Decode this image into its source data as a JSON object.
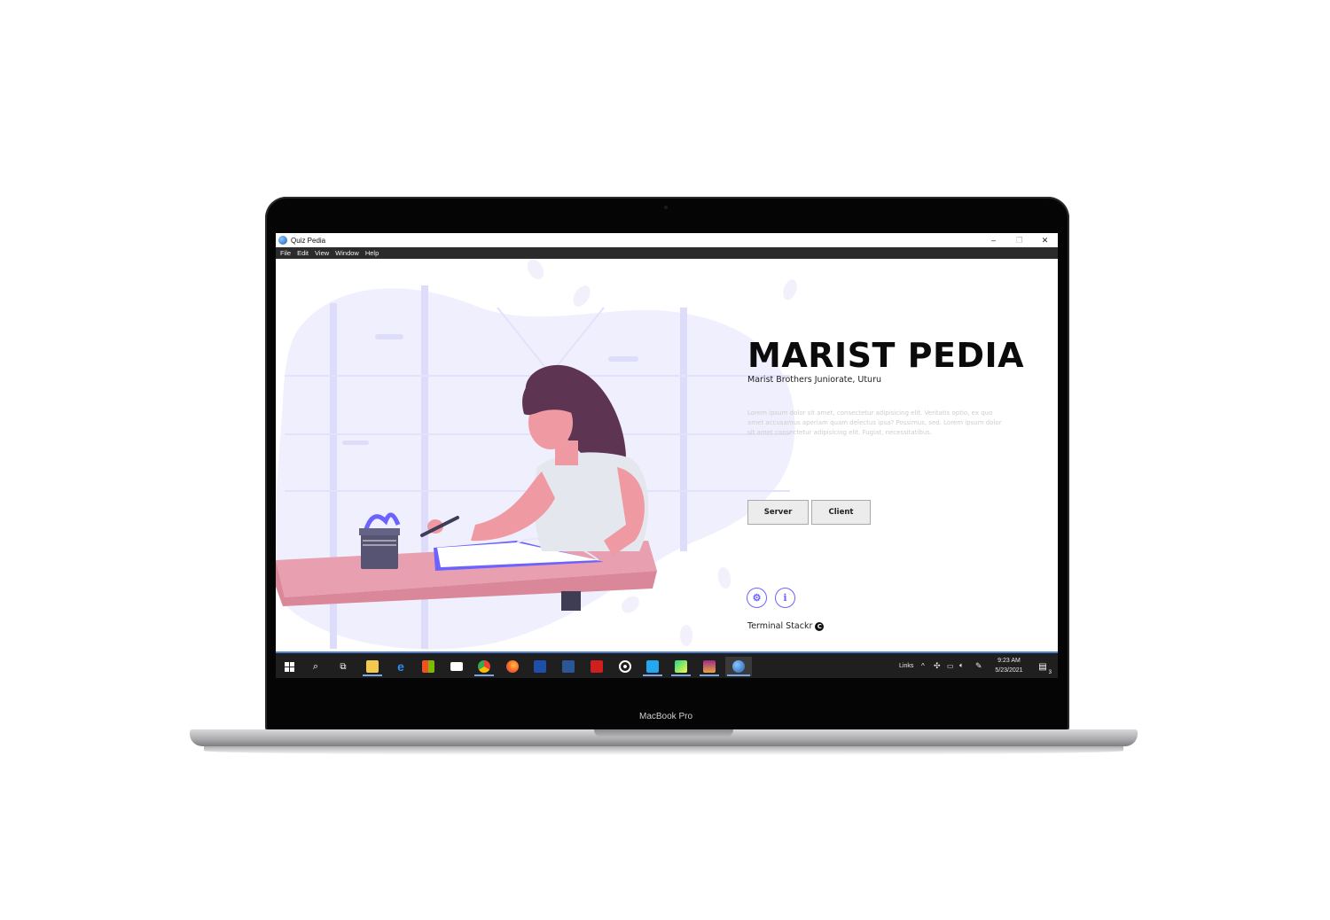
{
  "device": {
    "model_label": "MacBook Pro"
  },
  "window": {
    "title": "Quiz Pedia",
    "controls": {
      "minimize": "–",
      "restore": "❐",
      "close": "✕"
    }
  },
  "menu": [
    "File",
    "Edit",
    "View",
    "Window",
    "Help"
  ],
  "hero": {
    "title": "MARIST PEDIA",
    "subtitle": "Marist Brothers Juniorate, Uturu",
    "description": "Lorem ipsum dolor sit amet, consectetur adipisicing elit. Veritatis optio, ex quo amet accusamus aperiam quam delectus ipsa? Possimus, sed. Lorem ipsum dolor sit amet consectetur adipisicing elit. Fugiat, necessitatibus."
  },
  "buttons": {
    "server": "Server",
    "client": "Client"
  },
  "footer": {
    "brand": "Terminal Stackr",
    "copyright_symbol": "C"
  },
  "taskbar": {
    "tray_label": "Links",
    "time": "9:23 AM",
    "date": "5/23/2021",
    "notification_count": "3"
  },
  "colors": {
    "accent": "#6c63ff",
    "illustration_bg": "#f0effd",
    "menubar": "#2b2b2b",
    "taskbar": "#1f1f1f"
  }
}
